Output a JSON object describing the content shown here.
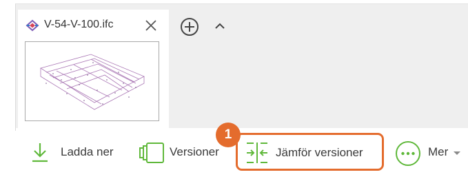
{
  "file_card": {
    "title": "V-54-V-100.ifc",
    "icons": {
      "file": "ifc-model-icon",
      "close": "close-icon"
    }
  },
  "tabs_controls": {
    "icons": {
      "add": "plus-circle-icon",
      "collapse": "chevron-up-icon"
    }
  },
  "toolbar": {
    "download_label": "Ladda ner",
    "versions_label": "Versioner",
    "compare_label": "Jämför versioner",
    "more_label": "Mer",
    "icons": {
      "download": "download-icon",
      "versions": "versions-icon",
      "compare": "compare-versions-icon",
      "more": "more-dots-icon",
      "more_caret": "caret-down-icon"
    }
  },
  "callout": {
    "step_number": "1"
  },
  "colors": {
    "accent_green": "#5fb83a",
    "highlight_orange": "#e46c2d",
    "panel_gray": "#efefef",
    "text_dark": "#333333"
  }
}
